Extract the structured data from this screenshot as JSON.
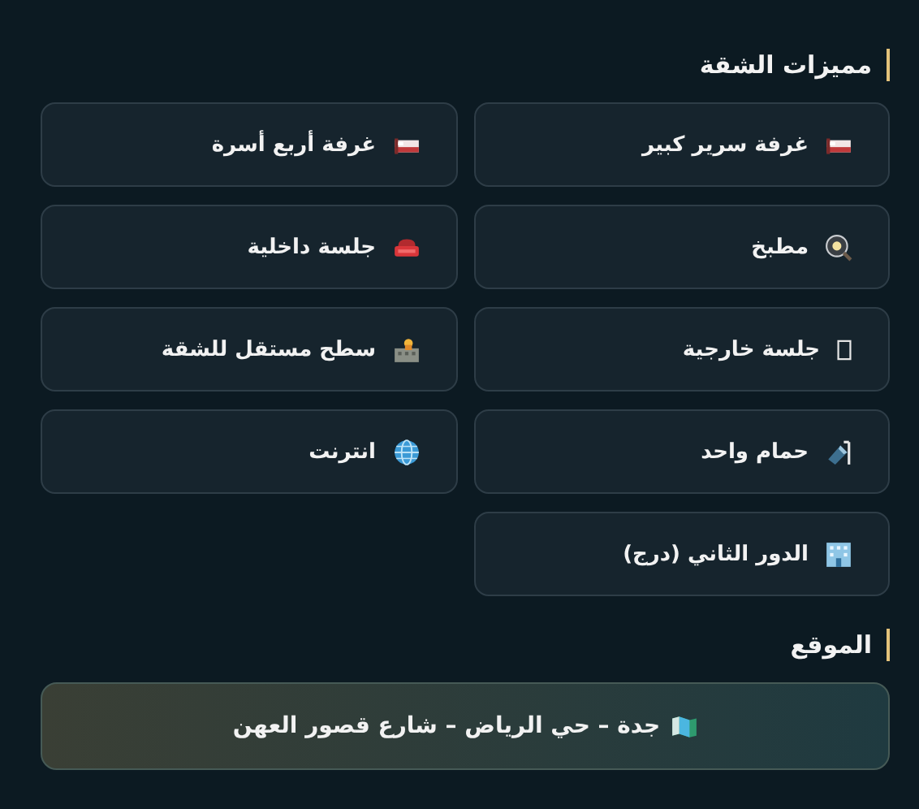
{
  "features": {
    "title": "مميزات الشقة",
    "items": [
      {
        "label": "غرفة سرير كبير"
      },
      {
        "label": "غرفة أربع أسرة"
      },
      {
        "label": "مطبخ"
      },
      {
        "label": "جلسة داخلية"
      },
      {
        "label": "جلسة خارجية"
      },
      {
        "label": "سطح مستقل للشقة"
      },
      {
        "label": "حمام واحد"
      },
      {
        "label": "انترنت"
      },
      {
        "label": "الدور الثاني (درج)"
      }
    ]
  },
  "location": {
    "title": "الموقع",
    "address": "جدة – حي الرياض – شارع قصور العهن"
  }
}
